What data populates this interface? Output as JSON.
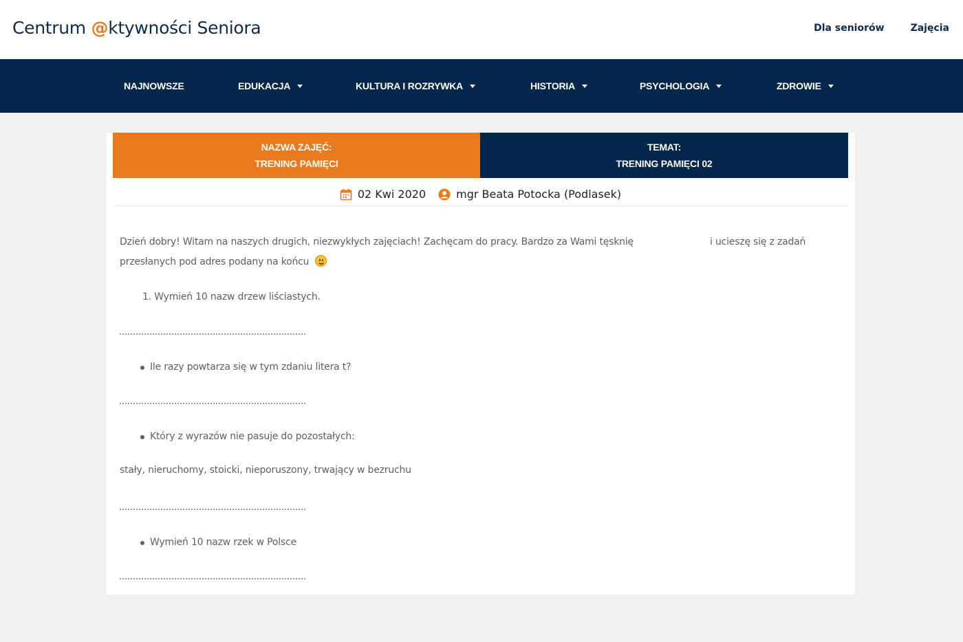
{
  "header": {
    "logo_prefix": "Centrum ",
    "logo_at": "@",
    "logo_suffix": "ktywności Seniora",
    "links": [
      "Dla seniorów",
      "Zajęcia"
    ]
  },
  "nav": {
    "items": [
      {
        "label": "NAJNOWSZE",
        "dropdown": false
      },
      {
        "label": "EDUKACJA",
        "dropdown": true
      },
      {
        "label": "KULTURA I ROZRYWKA",
        "dropdown": true
      },
      {
        "label": "HISTORIA",
        "dropdown": true
      },
      {
        "label": "PSYCHOLOGIA",
        "dropdown": true
      },
      {
        "label": "ZDROWIE",
        "dropdown": true
      }
    ]
  },
  "banner": {
    "left_title": "NAZWA ZAJĘĆ:",
    "left_value": "TRENING PAMIĘCI",
    "right_title": "TEMAT:",
    "right_value": "TRENING PAMIĘCI 02"
  },
  "meta": {
    "date": "02 Kwi 2020",
    "author": "mgr Beata Potocka (Podlasek)",
    "date_icon": "calendar-icon",
    "author_icon": "user-icon"
  },
  "content": {
    "intro_line1_a": "Dzień dobry! Witam na naszych drugich, niezwykłych zajęciach! Zachęcam do pracy. Bardzo za Wami tęsknię",
    "intro_line1_b": "i ucieszę się z zadań",
    "intro_line2": "przesłanych pod adres podany na końcu",
    "task1": "1. Wymień 10 nazw drzew liściastych.",
    "task2": "Ile razy powtarza się w tym zdaniu litera t?",
    "task3": "Który z wyrazów nie pasuje do pozostałych:",
    "task3_words": "stały, nieruchomy, stoicki, nieporuszony, trwający w bezruchu",
    "task4": "Wymień 10 nazw rzek w Polsce"
  },
  "colors": {
    "navy": "#03264a",
    "orange": "#e8791d"
  }
}
